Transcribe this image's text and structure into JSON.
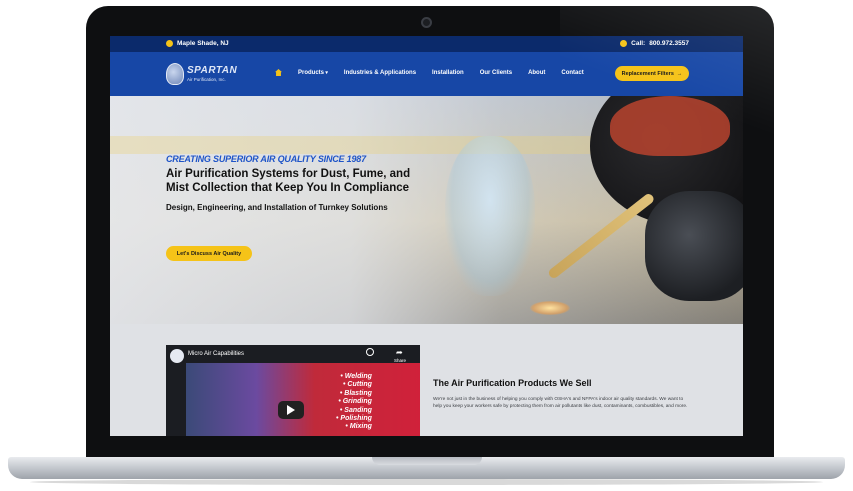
{
  "topbar": {
    "location": "Maple Shade, NJ",
    "call_label": "Call:",
    "phone": "800.972.3557"
  },
  "nav": {
    "logo_brand": "SPARTAN",
    "logo_sub": "Air Purification, Inc.",
    "items": [
      "Products",
      "Industries & Applications",
      "Installation",
      "Our Clients",
      "About",
      "Contact"
    ],
    "cta": "Replacement Filters",
    "cta_arrow": "→"
  },
  "hero": {
    "kicker": "CREATING SUPERIOR AIR QUALITY SINCE 1987",
    "headline": "Air Purification Systems for Dust, Fume, and Mist Collection that Keep You In Compliance",
    "subline": "Design, Engineering, and Installation of Turnkey Solutions",
    "cta": "Let's Discuss Air Quality"
  },
  "video": {
    "title": "Micro Air Capabilities",
    "share_label": "Share",
    "bullets": [
      "• Welding",
      "• Cutting",
      "• Blasting",
      "• Grinding",
      "• Sanding",
      "• Polishing",
      "• Mixing"
    ]
  },
  "products": {
    "title": "The Air Purification Products We Sell",
    "body": "We're not just in the business of helping you comply with OSHA's and NFPA's indoor air quality standards. We want to help you keep your workers safe by protecting them from air pollutants like dust, contaminants, combustibles, and more."
  },
  "colors": {
    "navy": "#0b2a6b",
    "nav_blue": "#1747a6",
    "accent_yellow": "#f5c318",
    "kicker_blue": "#1e54c8"
  }
}
